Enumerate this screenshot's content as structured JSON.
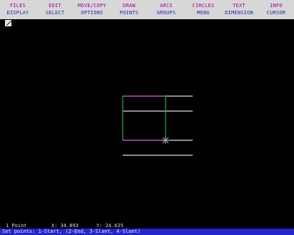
{
  "menu": [
    {
      "top": "FILES",
      "bottom": "DISPLAY"
    },
    {
      "top": "EDIT",
      "bottom": "SELECT"
    },
    {
      "top": "MOVE/COPY",
      "bottom": "OPTIONS"
    },
    {
      "top": "DRAW",
      "bottom": "POINTS"
    },
    {
      "top": "ARCS",
      "bottom": "GROUPS"
    },
    {
      "top": "CIRCLES",
      "bottom": "MENU"
    },
    {
      "top": "TEXT",
      "bottom": "DIMENSION"
    },
    {
      "top": "INFO",
      "bottom": "CURSOR"
    }
  ],
  "colors": {
    "menu_bg": "#d7d7d7",
    "menu_top_text": "#a0009a",
    "menu_bottom_text": "#2a1fb5",
    "canvas_bg": "#000000",
    "line_white": "#dddddd",
    "line_magenta": "#c040c0",
    "line_green": "#30a030",
    "prompt_bg": "#2626c8"
  },
  "status": {
    "mode": "1 Point",
    "x_readout": "X: 34.893",
    "y_readout": "Y: 24.625",
    "prompt": "Set points: 1-Start, (2-End, 3-Slant, 4-Slant)"
  }
}
